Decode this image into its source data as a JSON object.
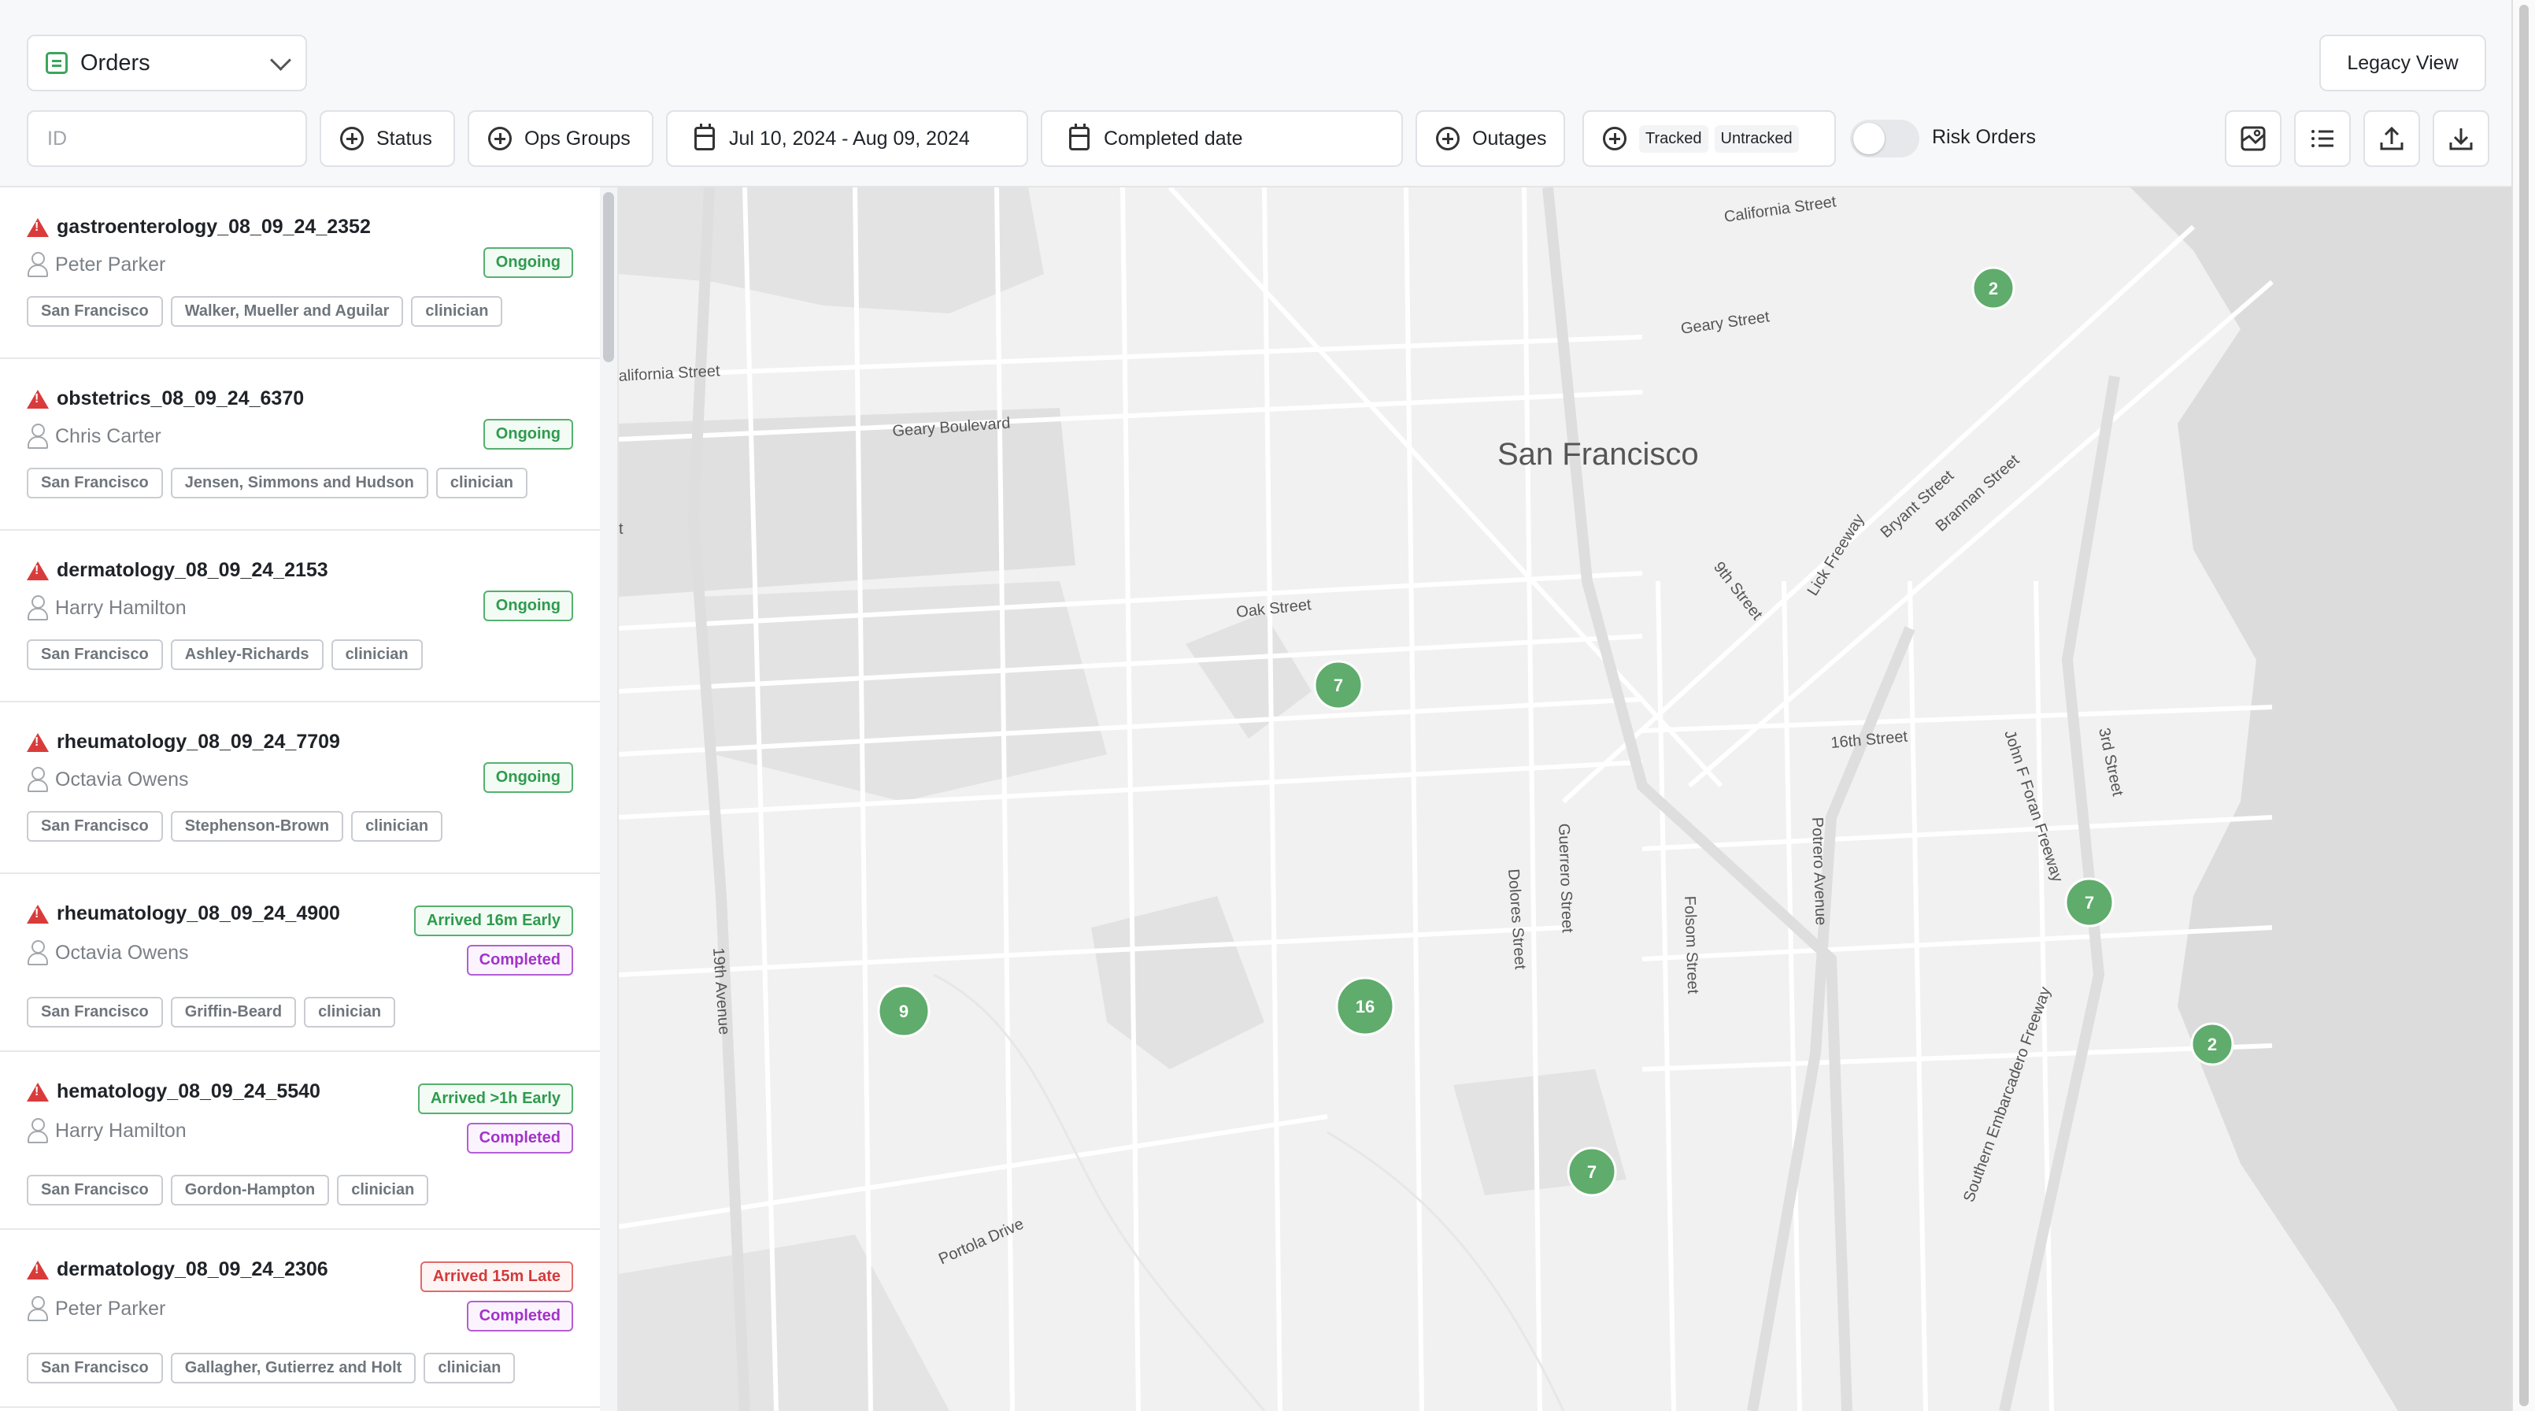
{
  "header": {
    "view_select": "Orders",
    "legacy_button": "Legacy View",
    "id_placeholder": "ID",
    "filters": {
      "status": "Status",
      "ops_groups": "Ops Groups",
      "date_range": "Jul 10, 2024 - Aug 09, 2024",
      "completed_date": "Completed date",
      "outages": "Outages",
      "tracked": "Tracked",
      "untracked": "Untracked",
      "risk_orders": "Risk Orders"
    },
    "risk_orders_enabled": false,
    "icons": [
      "map-view-icon",
      "list-view-icon",
      "upload-icon",
      "download-icon"
    ]
  },
  "orders": [
    {
      "name": "gastroenterology_08_09_24_2352",
      "person": "Peter Parker",
      "arrival": "",
      "status": "Ongoing",
      "tags": [
        "San Francisco",
        "Walker, Mueller and Aguilar",
        "clinician"
      ]
    },
    {
      "name": "obstetrics_08_09_24_6370",
      "person": "Chris Carter",
      "arrival": "",
      "status": "Ongoing",
      "tags": [
        "San Francisco",
        "Jensen, Simmons and Hudson",
        "clinician"
      ]
    },
    {
      "name": "dermatology_08_09_24_2153",
      "person": "Harry Hamilton",
      "arrival": "",
      "status": "Ongoing",
      "tags": [
        "San Francisco",
        "Ashley-Richards",
        "clinician"
      ]
    },
    {
      "name": "rheumatology_08_09_24_7709",
      "person": "Octavia Owens",
      "arrival": "",
      "status": "Ongoing",
      "tags": [
        "San Francisco",
        "Stephenson-Brown",
        "clinician"
      ]
    },
    {
      "name": "rheumatology_08_09_24_4900",
      "person": "Octavia Owens",
      "arrival": "Arrived 16m Early",
      "status": "Completed",
      "tags": [
        "San Francisco",
        "Griffin-Beard",
        "clinician"
      ]
    },
    {
      "name": "hematology_08_09_24_5540",
      "person": "Harry Hamilton",
      "arrival": "Arrived >1h Early",
      "status": "Completed",
      "tags": [
        "San Francisco",
        "Gordon-Hampton",
        "clinician"
      ]
    },
    {
      "name": "dermatology_08_09_24_2306",
      "person": "Peter Parker",
      "arrival": "Arrived 15m Late",
      "status": "Completed",
      "tags": [
        "San Francisco",
        "Gallagher, Gutierrez and Holt",
        "clinician"
      ]
    }
  ],
  "map": {
    "city_label": "San Francisco",
    "streets": [
      "California Street",
      "Geary Street",
      "alifornia Street",
      "Geary Boulevard",
      "Oak Street",
      "9th Street",
      "Bryant Street",
      "Brannan Street",
      "Lick Freeway",
      "16th Street",
      "3rd Street",
      "John F Foran Freeway",
      "Guerrero Street",
      "Dolores Street",
      "Potrero Avenue",
      "Folsom Street",
      "19th Avenue",
      "Portola Drive",
      "Southern Embarcadero Freeway",
      "t"
    ],
    "clusters": [
      "2",
      "7",
      "7",
      "9",
      "16",
      "2",
      "7"
    ],
    "cluster_color": "#5fac6c"
  },
  "colors": {
    "accent_green": "#3aa65a",
    "danger": "#d93b3b",
    "completed_purple": "#a233c8"
  }
}
